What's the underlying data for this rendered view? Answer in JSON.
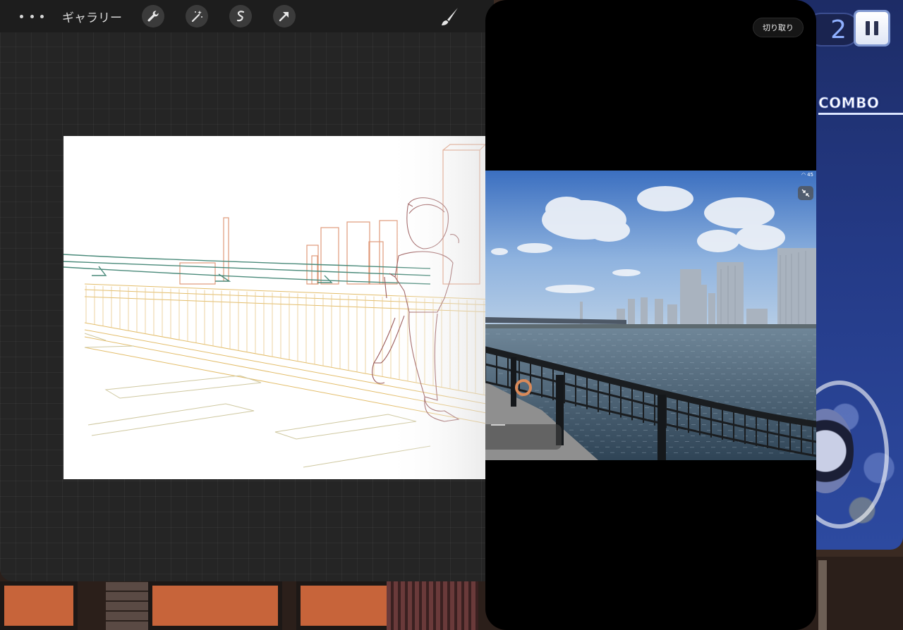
{
  "toolbar": {
    "gallery_label": "ギャラリー",
    "tools": [
      "wrench-icon",
      "magic-wand-icon",
      "selection-icon",
      "transform-arrow-icon"
    ],
    "brush": "brush-icon"
  },
  "float_panel": {
    "crop_label": "切り取り",
    "status_text": "45"
  },
  "game": {
    "score_fragment": "2",
    "combo_label": "COMBO"
  },
  "colors": {
    "app_bg": "#252525",
    "toolbar_bg": "#1d1d1d",
    "sketch_rail": "#e0b85a",
    "sketch_building": "#e09070",
    "sketch_bridge": "#4a8a7a",
    "sketch_figure": "#9a5a5a"
  }
}
